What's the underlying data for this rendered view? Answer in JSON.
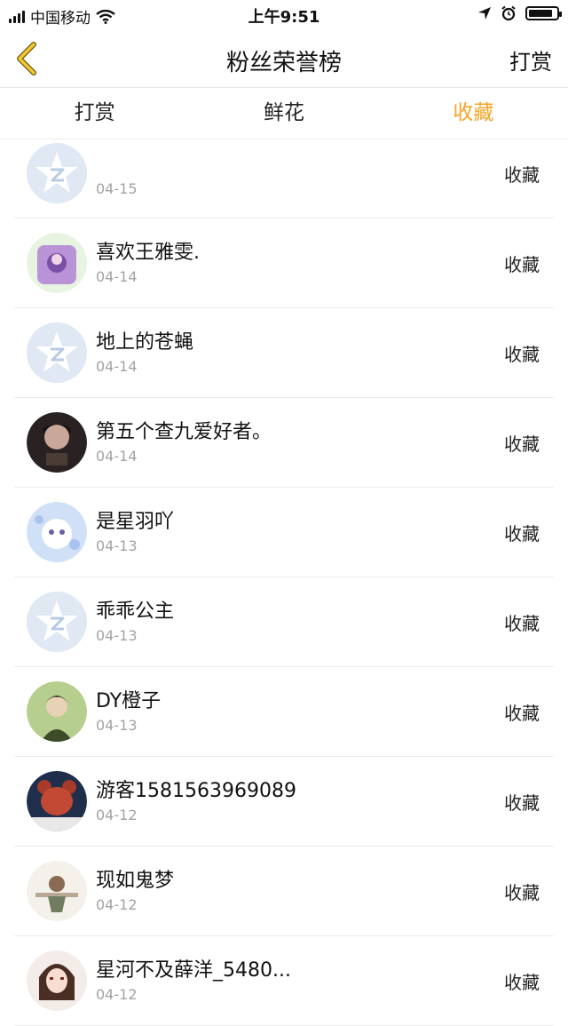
{
  "status_bar": {
    "carrier": "中国移动",
    "time": "上午9:51"
  },
  "nav": {
    "title": "粉丝荣誉榜",
    "right_label": "打赏"
  },
  "tabs": [
    {
      "label": "打赏",
      "active": false
    },
    {
      "label": "鲜花",
      "active": false
    },
    {
      "label": "收藏",
      "active": true
    }
  ],
  "accent_color": "#f3a524",
  "items": [
    {
      "name": "",
      "date": "04-15",
      "action": "收藏",
      "avatar": "default-avatar"
    },
    {
      "name": "喜欢王雅雯.",
      "date": "04-14",
      "action": "收藏",
      "avatar": "photo-avatar"
    },
    {
      "name": "地上的苍蝇",
      "date": "04-14",
      "action": "收藏",
      "avatar": "default-avatar"
    },
    {
      "name": "第五个查九爱好者。",
      "date": "04-14",
      "action": "收藏",
      "avatar": "photo-avatar"
    },
    {
      "name": "是星羽吖",
      "date": "04-13",
      "action": "收藏",
      "avatar": "photo-avatar"
    },
    {
      "name": "乖乖公主",
      "date": "04-13",
      "action": "收藏",
      "avatar": "default-avatar"
    },
    {
      "name": "DY橙子",
      "date": "04-13",
      "action": "收藏",
      "avatar": "photo-avatar"
    },
    {
      "name": "游客1581563969089",
      "date": "04-12",
      "action": "收藏",
      "avatar": "photo-avatar"
    },
    {
      "name": "现如鬼梦",
      "date": "04-12",
      "action": "收藏",
      "avatar": "photo-avatar"
    },
    {
      "name": "星河不及薛洋_5480...",
      "date": "04-12",
      "action": "收藏",
      "avatar": "photo-avatar"
    }
  ]
}
